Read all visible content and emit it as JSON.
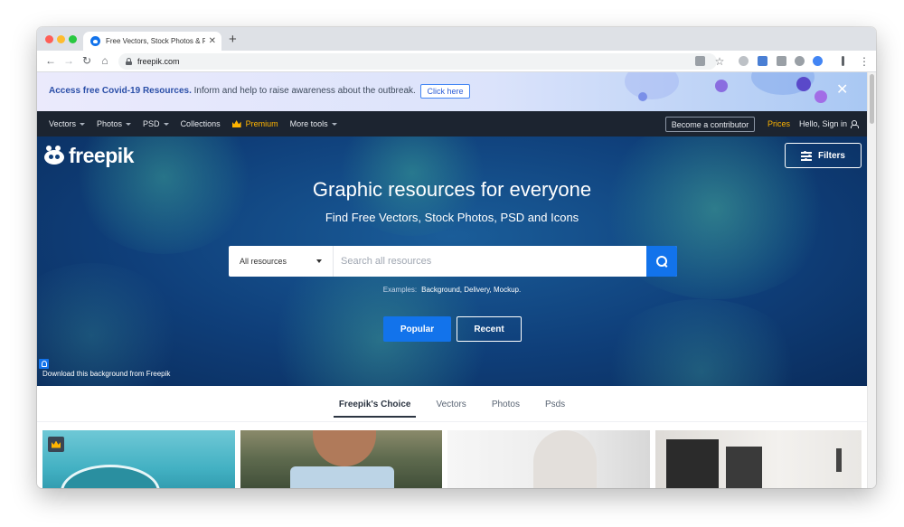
{
  "browser": {
    "tab_title": "Free Vectors, Stock Photos & PSD",
    "tab_close": "✕",
    "new_tab": "+",
    "url": "freepik.com",
    "back": "←",
    "forward": "→",
    "reload": "↻",
    "home": "⌂",
    "star": "☆",
    "menu": "⋮",
    "icons": [
      "lock-icon",
      "translate-icon",
      "star-icon",
      "extension-icon",
      "menu-icon"
    ]
  },
  "banner": {
    "strong_text": "Access free Covid-19 Resources.",
    "text": " Inform and help to raise awareness about the outbreak.",
    "button": "Click here",
    "close": "✕"
  },
  "nav": {
    "vectors": "Vectors",
    "photos": "Photos",
    "psd": "PSD",
    "collections": "Collections",
    "premium": "Premium",
    "more_tools": "More tools",
    "contributor": "Become a contributor",
    "prices": "Prices",
    "signin": "Hello, Sign in"
  },
  "hero": {
    "logo": "freepik",
    "filters": "Filters",
    "title": "Graphic resources for everyone",
    "subtitle": "Find Free Vectors, Stock Photos, PSD and Icons",
    "select_value": "All resources",
    "search_placeholder": "Search all resources",
    "examples_label": "Examples:",
    "examples": "Background, Delivery, Mockup.",
    "popular": "Popular",
    "recent": "Recent",
    "download_bg": "Download this background from Freepik"
  },
  "categories": {
    "tabs": [
      "Freepik's Choice",
      "Vectors",
      "Photos",
      "Psds"
    ]
  },
  "colors": {
    "brand_blue": "#1273eb",
    "nav_dark": "#1c2430",
    "premium_gold": "#ffb400",
    "hero_blue": "#0f3f7a"
  }
}
